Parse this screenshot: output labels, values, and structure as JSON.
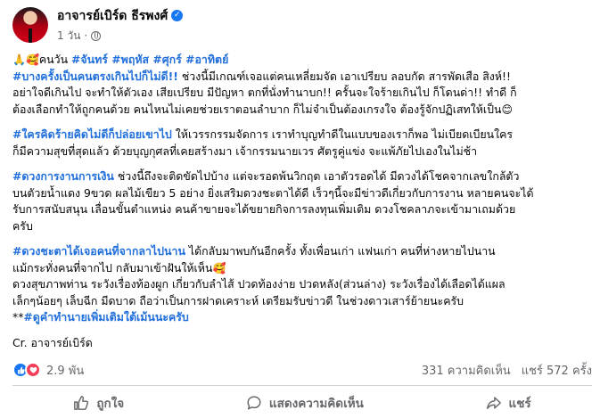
{
  "author": {
    "name": "อาจารย์เบิร์ด ธีรพงศ์",
    "time": "1 วัน",
    "time_separator": "·"
  },
  "post": {
    "p1": [
      [
        {
          "t": "🙏🥰",
          "c": "emoji"
        },
        {
          "t": "คนวัน ",
          "c": ""
        },
        {
          "t": "#จันทร์ #พฤหัส #ศุกร์ #อาทิตย์",
          "c": "hashtag"
        }
      ],
      [
        {
          "t": "#บางครั้งเป็นคนตรงเกินไปก็ไม่ดี!!",
          "c": "hashtag"
        },
        {
          "t": " ช่วงนี้มีเกณฑ์เจอแต่คนเหลี่ยมจัด เอาเปรียบ ลอบกัด สารพัดเสือ สิงห์!!",
          "c": ""
        }
      ],
      [
        {
          "t": "อย่าใจดีเกินไป จะทำให้ตัวเอง เสียเปรียบ มีปัญหา ตกที่นั่งทำนาบก!! ครั้นจะใจร้ายเกินไป ก็โดนด่า!! ทำดี ก็",
          "c": ""
        }
      ],
      [
        {
          "t": "ต้องเลือกทำให้ถูกคนด้วย คนไหนไม่เคยช่วยเราตอนลำบาก ก็ไม่จำเป็นต้องเกรงใจ ต้องรู้จักปฏิเสทให้เป็น",
          "c": ""
        },
        {
          "t": "😊",
          "c": "emoji"
        }
      ]
    ],
    "p2": [
      [
        {
          "t": "#ใครคิดร้ายคิดไม่ดีก็ปล่อยเขาไป",
          "c": "hashtag"
        },
        {
          "t": " ให้เวรรกรรมจัดการ เราทำบุญทำดีในแบบของเราก็พอ ไม่เบียดเบียนใคร",
          "c": ""
        }
      ],
      [
        {
          "t": "ก็มีความสุขที่สุดแล้ว ด้วยบุญกุศลที่เคยสร้างมา เจ้ากรรมนายเวร ศัตรูคู่แข่ง จะแพ้ภัยไปเองในไม่ช้า",
          "c": ""
        }
      ]
    ],
    "p3": [
      [
        {
          "t": "#ดวงการงานการเงิน",
          "c": "hashtag"
        },
        {
          "t": " ช่วงนี้ถึงจะติดขัดไปบ้าง แต่จะรอดพ้นวิกฤต เอาตัวรอดได้ มีดวงได้โชคจากเลขใกล้ตัว",
          "c": ""
        }
      ],
      [
        {
          "t": "บนตัวยน้ำแดง 9ขวด ผลไม้เขียว 5 อย่าง ยิ่งเสริมดวงชะตาได้ดี เร็วๆนี้จะมีข่าวดีเกี่ยวกับการงาน หลายคนจะได้",
          "c": ""
        }
      ],
      [
        {
          "t": "รับการสนับสนุน เลื่อนขั้นตำแหน่ง คนค้าขายจะได้ขยายกิจการลงทุนเพิ่มเติม ดวงโชคลาภจะเข้ามาเถมด้วย",
          "c": ""
        }
      ],
      [
        {
          "t": "ครับ",
          "c": ""
        }
      ]
    ],
    "p4": [
      [
        {
          "t": "#ดวงชะตาได้เจอคนที่จากลาไปนาน",
          "c": "hashtag"
        },
        {
          "t": " ได้กลับมาพบกันอีกครั้ง ทั้งเพื่อนเก่า แฟนเก่า คนที่ห่างหายไปนาน",
          "c": ""
        }
      ],
      [
        {
          "t": "แม้กระทั่งคนที่จากไป กลับมาเข้าฝันให้เห็น",
          "c": ""
        },
        {
          "t": "🥰",
          "c": "emoji"
        }
      ],
      [
        {
          "t": "ดวงสุขภาพท่าน ระวังเรื่องท้องผูก เกี่ยวกับลำไส้ ปวดท้องง่าย ปวดหลัง(ส่วนล่าง) ระวังเรื่องได้เลือดได้แผล",
          "c": ""
        }
      ],
      [
        {
          "t": "เล็กๆน้อยๆ เล็บฉีก มีดบาด ถือว่าเป็นการฝาดเคราะห์ เตรียมรับข่าวดี ในช่วงดาวเสาร์ย้ายนะครับ",
          "c": ""
        }
      ],
      [
        {
          "t": "**",
          "c": ""
        },
        {
          "t": "#ดูคำทำนายเพิ่มเติมใต้เม้นนะครับ",
          "c": "hashtag"
        }
      ]
    ],
    "p5": [
      [
        {
          "t": "Cr. อาจารย์เบิร์ด",
          "c": ""
        }
      ]
    ]
  },
  "reactions": {
    "count": "2.9 พัน",
    "comments": "331 ความคิดเห็น",
    "shares": "แชร์ 572 ครั้ง",
    "icons": [
      "like-icon",
      "love-icon"
    ],
    "like_color": "#1877f2",
    "love_color": "#f33e58"
  },
  "actions": {
    "like": "ถูกใจ",
    "comment": "แสดงความคิดเห็น",
    "share": "แชร์"
  },
  "colors": {
    "hashtag": "#216fdb",
    "secondary_text": "#65676b",
    "verified": "#1877f2"
  }
}
